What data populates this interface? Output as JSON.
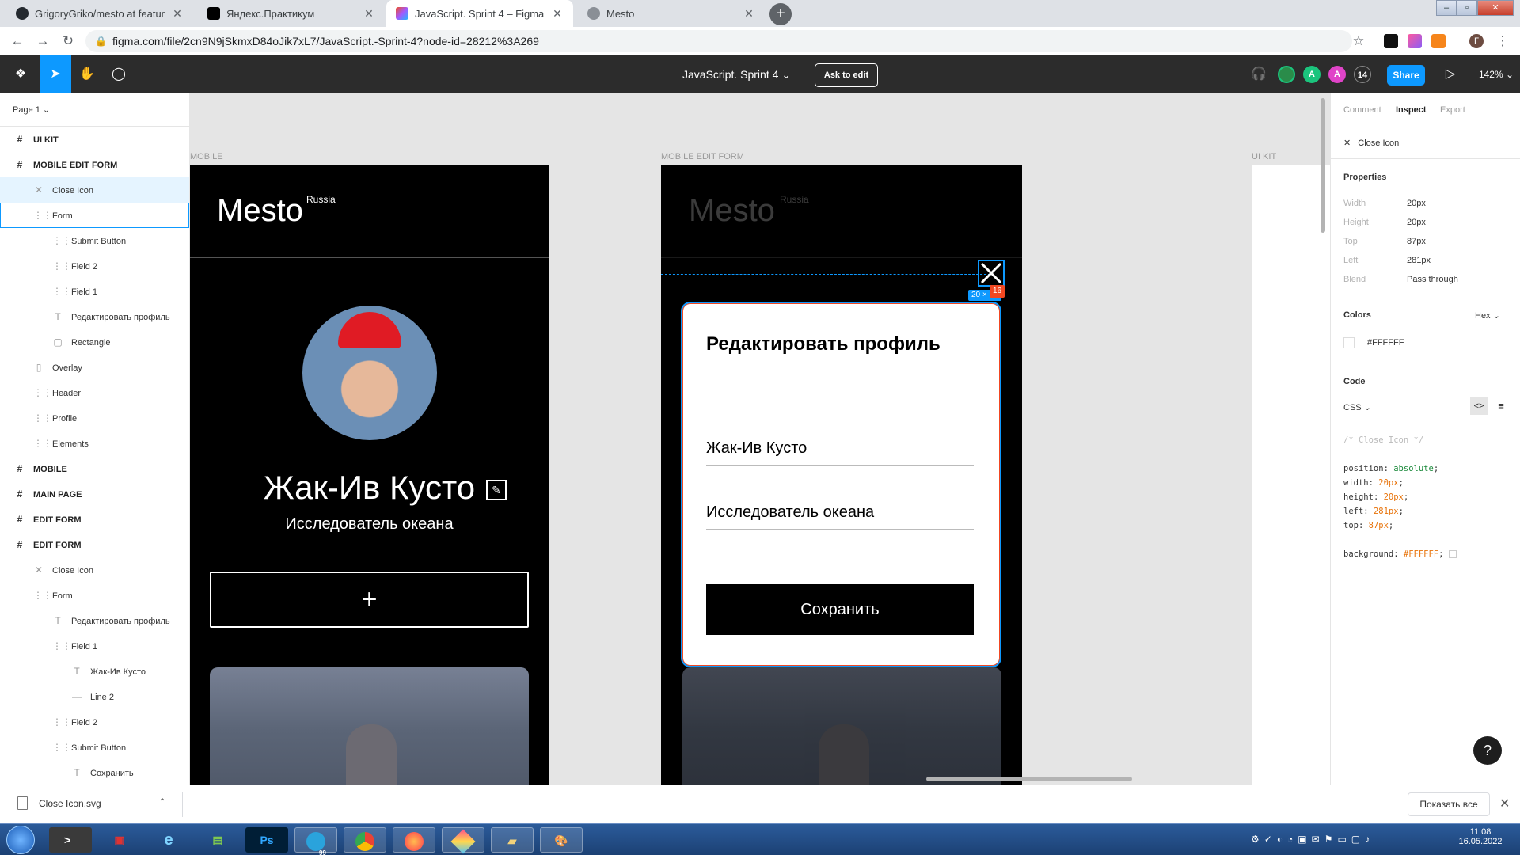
{
  "browser": {
    "tabs": [
      {
        "title": "GrigoryGriko/mesto at feature/h",
        "active": false,
        "icon": "github-icon"
      },
      {
        "title": "Яндекс.Практикум",
        "active": false,
        "icon": "praktikum-icon"
      },
      {
        "title": "JavaScript. Sprint 4 – Figma",
        "active": true,
        "icon": "figma-icon"
      },
      {
        "title": "Mesto",
        "active": false,
        "icon": "globe-icon"
      }
    ],
    "url": "figma.com/file/2cn9N9jSkmxD84oJik7xL7/JavaScript.-Sprint-4?node-id=28212%3A269"
  },
  "figma": {
    "doc_title": "JavaScript. Sprint 4",
    "ask_to_edit": "Ask to edit",
    "share": "Share",
    "zoom": "142%",
    "collaborators": [
      "A",
      "A"
    ],
    "collaborator_count": "14"
  },
  "layers": {
    "page": "Page 1",
    "items": [
      {
        "label": "UI KIT",
        "icon": "#",
        "kind": "frame",
        "depth": 0
      },
      {
        "label": "MOBILE EDIT FORM",
        "icon": "#",
        "kind": "frame",
        "depth": 0
      },
      {
        "label": "Close Icon",
        "icon": "✕",
        "kind": "selected",
        "depth": 1
      },
      {
        "label": "Form",
        "icon": "⋮⋮",
        "kind": "outlined",
        "depth": 1
      },
      {
        "label": "Submit Button",
        "icon": "⋮⋮",
        "kind": "item",
        "depth": 2
      },
      {
        "label": "Field 2",
        "icon": "⋮⋮",
        "kind": "item",
        "depth": 2
      },
      {
        "label": "Field 1",
        "icon": "⋮⋮",
        "kind": "item",
        "depth": 2
      },
      {
        "label": "Редактировать профиль",
        "icon": "T",
        "kind": "item",
        "depth": 2
      },
      {
        "label": "Rectangle",
        "icon": "▢",
        "kind": "item",
        "depth": 2
      },
      {
        "label": "Overlay",
        "icon": "▯",
        "kind": "item",
        "depth": 1
      },
      {
        "label": "Header",
        "icon": "⋮⋮",
        "kind": "item",
        "depth": 1
      },
      {
        "label": "Profile",
        "icon": "⋮⋮",
        "kind": "item",
        "depth": 1
      },
      {
        "label": "Elements",
        "icon": "⋮⋮",
        "kind": "item",
        "depth": 1
      },
      {
        "label": "MOBILE",
        "icon": "#",
        "kind": "frame",
        "depth": 0
      },
      {
        "label": "MAIN PAGE",
        "icon": "#",
        "kind": "frame",
        "depth": 0
      },
      {
        "label": "EDIT FORM",
        "icon": "#",
        "kind": "frame",
        "depth": 0
      },
      {
        "label": "EDIT FORM",
        "icon": "#",
        "kind": "frame",
        "depth": 0
      },
      {
        "label": "Close Icon",
        "icon": "✕",
        "kind": "item",
        "depth": 1
      },
      {
        "label": "Form",
        "icon": "⋮⋮",
        "kind": "item",
        "depth": 1
      },
      {
        "label": "Редактировать профиль",
        "icon": "T",
        "kind": "item",
        "depth": 2
      },
      {
        "label": "Field 1",
        "icon": "⋮⋮",
        "kind": "item",
        "depth": 2
      },
      {
        "label": "Жак-Ив Кусто",
        "icon": "T",
        "kind": "item",
        "depth": 3
      },
      {
        "label": "Line 2",
        "icon": "—",
        "kind": "item",
        "depth": 3
      },
      {
        "label": "Field 2",
        "icon": "⋮⋮",
        "kind": "item",
        "depth": 2
      },
      {
        "label": "Submit Button",
        "icon": "⋮⋮",
        "kind": "item",
        "depth": 2
      },
      {
        "label": "Сохранить",
        "icon": "T",
        "kind": "item",
        "depth": 3
      }
    ]
  },
  "canvas": {
    "label_mobile": "MOBILE",
    "label_mobile_edit": "MOBILE EDIT FORM",
    "label_ui_kit": "UI KIT",
    "logo": "Mesto",
    "logo_sup": "Russia",
    "profile_name": "Жак-Ив Кусто",
    "profile_job": "Исследователь океана",
    "add_symbol": "+",
    "edit_symbol": "✎",
    "modal_title": "Редактировать профиль",
    "field_name": "Жак-Ив Кусто",
    "field_job": "Исследователь океана",
    "save": "Сохранить",
    "size_badge": "20 × 20",
    "distance_badge": "16"
  },
  "inspect": {
    "tabs": [
      "Comment",
      "Inspect",
      "Export"
    ],
    "active_tab": "Inspect",
    "layer_name": "Close Icon",
    "properties_title": "Properties",
    "properties": [
      {
        "k": "Width",
        "v": "20px"
      },
      {
        "k": "Height",
        "v": "20px"
      },
      {
        "k": "Top",
        "v": "87px"
      },
      {
        "k": "Left",
        "v": "281px"
      },
      {
        "k": "Blend",
        "v": "Pass through"
      }
    ],
    "colors_title": "Colors",
    "color_format": "Hex",
    "color_value": "#FFFFFF",
    "code_title": "Code",
    "code_lang": "CSS",
    "code_comment": "/* Close Icon */",
    "code_lines": [
      {
        "k": "position",
        "v": "absolute"
      },
      {
        "k": "width",
        "v": "20px"
      },
      {
        "k": "height",
        "v": "20px"
      },
      {
        "k": "left",
        "v": "281px"
      },
      {
        "k": "top",
        "v": "87px"
      }
    ],
    "code_bg_key": "background",
    "code_bg_val": "#FFFFFF"
  },
  "download": {
    "file": "Close Icon.svg",
    "show_all": "Показать все"
  },
  "taskbar": {
    "time": "11:08",
    "date": "16.05.2022",
    "telegram_badge": "99"
  },
  "colors": {
    "figma_blue": "#0d99ff",
    "toolbar": "#2c2c2c",
    "selection_red": "#f24822"
  }
}
